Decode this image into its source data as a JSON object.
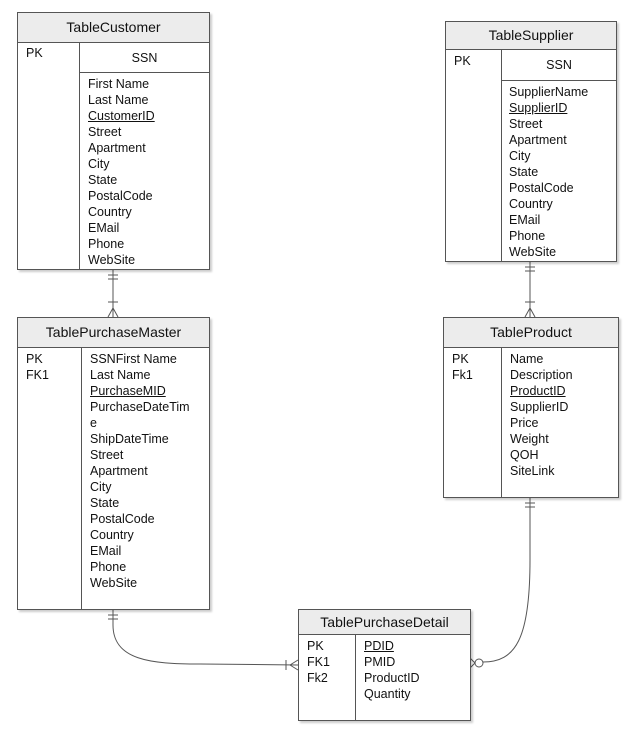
{
  "entities": {
    "customer": {
      "title": "TableCustomer",
      "keys": [
        "PK"
      ],
      "pk_field": "SSN",
      "fields": [
        "First Name",
        "Last Name",
        "CustomerID",
        "Street",
        "Apartment",
        "City",
        "State",
        "PostalCode",
        "Country",
        "EMail",
        "Phone",
        "WebSite"
      ],
      "underlined": [
        "CustomerID"
      ]
    },
    "supplier": {
      "title": "TableSupplier",
      "keys": [
        "PK"
      ],
      "pk_field": "SSN",
      "fields": [
        "SupplierName",
        "SupplierID",
        "Street",
        "Apartment",
        "City",
        "State",
        "PostalCode",
        "Country",
        "EMail",
        "Phone",
        "WebSite"
      ],
      "underlined": [
        "SupplierID"
      ]
    },
    "purchase_master": {
      "title": "TablePurchaseMaster",
      "keys": [
        "PK",
        "FK1"
      ],
      "fields": [
        "SSNFirst Name",
        "Last Name",
        "PurchaseMID",
        "PurchaseDateTim",
        "e",
        "ShipDateTime",
        "Street",
        "Apartment",
        "City",
        "State",
        "PostalCode",
        "Country",
        "EMail",
        "Phone",
        "WebSite"
      ],
      "underlined": [
        "PurchaseMID"
      ]
    },
    "product": {
      "title": "TableProduct",
      "keys": [
        "PK",
        "Fk1"
      ],
      "fields": [
        "Name",
        "Description",
        "ProductID",
        "SupplierID",
        "Price",
        "Weight",
        "QOH",
        "SiteLink"
      ],
      "underlined": [
        "ProductID"
      ]
    },
    "purchase_detail": {
      "title": "TablePurchaseDetail",
      "keys": [
        "PK",
        "FK1",
        "Fk2"
      ],
      "fields": [
        "PDID",
        "PMID",
        "ProductID",
        "Quantity"
      ],
      "underlined": [
        "PDID"
      ]
    }
  },
  "relationships": [
    {
      "from": "TableCustomer",
      "to": "TablePurchaseMaster",
      "from_end": "one-and-only-one",
      "to_end": "one-or-many"
    },
    {
      "from": "TableSupplier",
      "to": "TableProduct",
      "from_end": "one-and-only-one",
      "to_end": "one-or-many"
    },
    {
      "from": "TablePurchaseMaster",
      "to": "TablePurchaseDetail",
      "from_end": "one-and-only-one",
      "to_end": "one-or-many"
    },
    {
      "from": "TableProduct",
      "to": "TablePurchaseDetail",
      "from_end": "one-and-only-one",
      "to_end": "zero-or-many"
    }
  ],
  "colors": {
    "border": "#555555",
    "header": "#ececec",
    "line": "#555555"
  }
}
